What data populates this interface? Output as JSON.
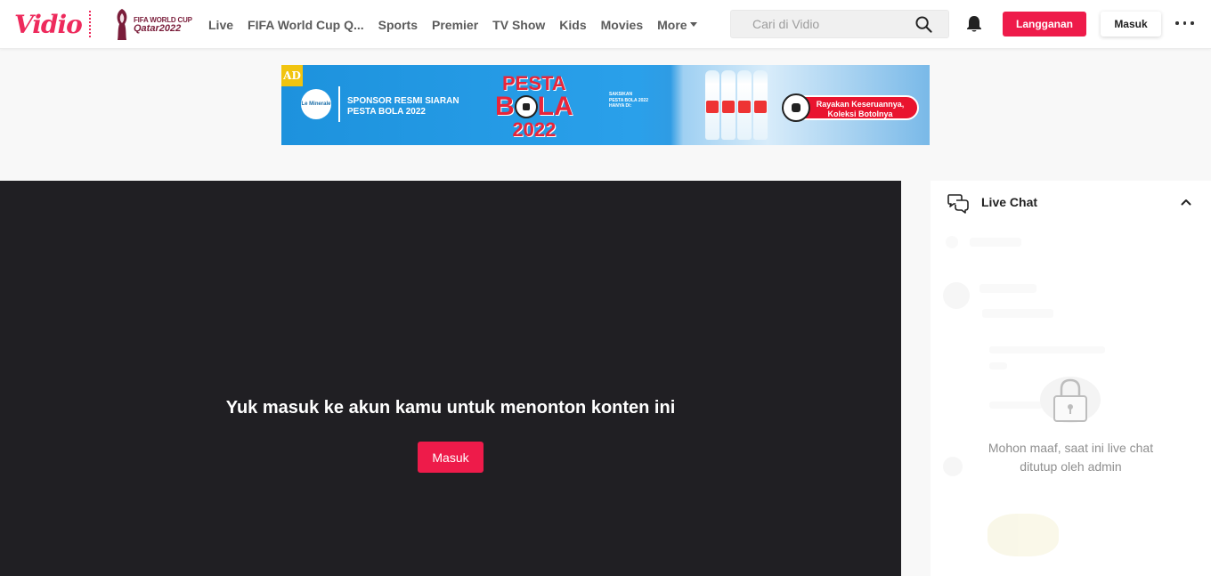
{
  "header": {
    "logo_text": "Vidio",
    "wc_logo_line1": "FIFA WORLD CUP",
    "wc_logo_line2": "Qatar2022",
    "nav": [
      "Live",
      "FIFA World Cup Q...",
      "Sports",
      "Premier",
      "TV Show",
      "Kids",
      "Movies",
      "More"
    ],
    "search_placeholder": "Cari di Vidio",
    "subscribe_label": "Langganan",
    "login_label": "Masuk"
  },
  "ad": {
    "badge": "AD",
    "brand": "Le Minerale",
    "sponsor_line1": "SPONSOR RESMI SIARAN",
    "sponsor_line2": "PESTA BOLA 2022",
    "pesta": "PESTA",
    "bola_b": "B",
    "bola_la": "LA",
    "year": "2022",
    "small_line1": "SAKSIKAN",
    "small_line2": "PESTA BOLA 2022",
    "small_line3": "HANYA DI:",
    "pill_line1": "Rayakan Keseruannya,",
    "pill_line2": "Koleksi Botolnya"
  },
  "player": {
    "message": "Yuk masuk ke akun kamu untuk menonton konten ini",
    "button_label": "Masuk"
  },
  "chat": {
    "title": "Live Chat",
    "closed_line1": "Mohon maaf, saat ini live chat",
    "closed_line2": "ditutup oleh admin"
  },
  "colors": {
    "brand_red": "#ee1b4a",
    "player_bg": "#201f23"
  }
}
